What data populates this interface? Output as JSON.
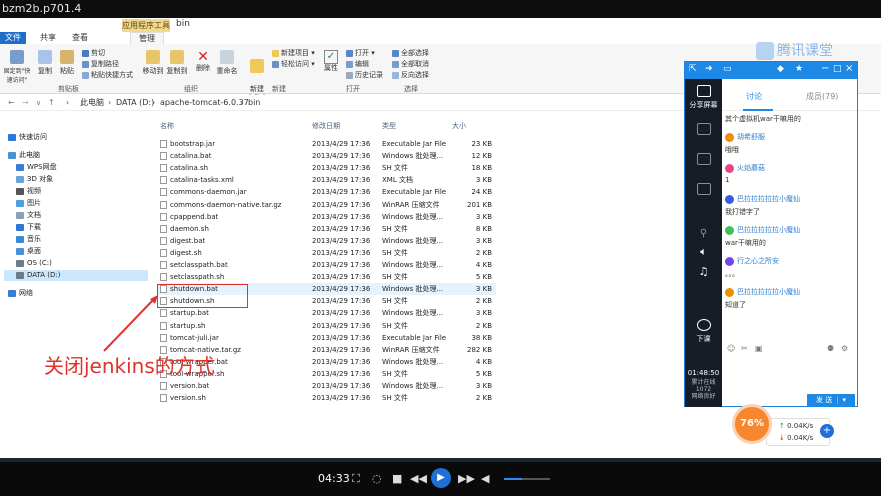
{
  "player": {
    "title": "bzm2b.p701.4",
    "time": "04:33",
    "volume_level": 0.4,
    "icons": [
      "fullscreen-icon",
      "list-icon",
      "stop-icon",
      "prev-icon",
      "play-icon",
      "next-icon",
      "repeat-icon",
      "volume-icon"
    ]
  },
  "explorer": {
    "app_tools_tab": "应用程序工具",
    "window_name": "bin",
    "tabs": [
      "文件",
      "共享",
      "查看",
      "管理"
    ],
    "ribbon": {
      "pin": "固定到\"快速访问\"",
      "copy": "复制",
      "paste": "粘贴",
      "cut": "剪切",
      "copy_path": "复制路径",
      "paste_shortcut": "粘贴快捷方式",
      "move_to": "移动到",
      "copy_to": "复制到",
      "delete": "删除",
      "rename": "重命名",
      "new_folder": "新建\n文件夹",
      "new_item": "新建项目 ▾",
      "easy_access": "轻松访问 ▾",
      "properties": "属性",
      "open": "打开 ▾",
      "edit": "编辑",
      "history": "历史记录",
      "select_all": "全部选择",
      "select_none": "全部取消",
      "invert": "反向选择",
      "groups": {
        "clipboard": "剪贴板",
        "organize": "组织",
        "new": "新建",
        "open": "打开",
        "select": "选择"
      }
    },
    "address": {
      "crumbs": [
        "此电脑",
        "DATA (D:)",
        "apache-tomcat-6.0.37",
        "bin"
      ]
    },
    "nav": [
      {
        "label": "快速访问",
        "type": "star"
      },
      {
        "label": "此电脑",
        "type": "pc"
      },
      {
        "label": "WPS网盘",
        "type": "cloud"
      },
      {
        "label": "3D 对象",
        "type": "folder"
      },
      {
        "label": "视频",
        "type": "folder"
      },
      {
        "label": "图片",
        "type": "folder"
      },
      {
        "label": "文档",
        "type": "folder"
      },
      {
        "label": "下载",
        "type": "folder"
      },
      {
        "label": "音乐",
        "type": "folder"
      },
      {
        "label": "桌面",
        "type": "folder"
      },
      {
        "label": "OS (C:)",
        "type": "drive"
      },
      {
        "label": "DATA (D:)",
        "type": "drive"
      },
      {
        "label": "网络",
        "type": "net"
      }
    ],
    "columns": {
      "name": "名称",
      "date": "修改日期",
      "type": "类型",
      "size": "大小"
    },
    "files": [
      {
        "name": "bootstrap.jar",
        "date": "2013/4/29 17:36",
        "type": "Executable Jar File",
        "size": "23 KB"
      },
      {
        "name": "catalina.bat",
        "date": "2013/4/29 17:36",
        "type": "Windows 批处理...",
        "size": "12 KB"
      },
      {
        "name": "catalina.sh",
        "date": "2013/4/29 17:36",
        "type": "SH 文件",
        "size": "18 KB"
      },
      {
        "name": "catalina-tasks.xml",
        "date": "2013/4/29 17:36",
        "type": "XML 文档",
        "size": "3 KB"
      },
      {
        "name": "commons-daemon.jar",
        "date": "2013/4/29 17:36",
        "type": "Executable Jar File",
        "size": "24 KB"
      },
      {
        "name": "commons-daemon-native.tar.gz",
        "date": "2013/4/29 17:36",
        "type": "WinRAR 压缩文件",
        "size": "201 KB"
      },
      {
        "name": "cpappend.bat",
        "date": "2013/4/29 17:36",
        "type": "Windows 批处理...",
        "size": "3 KB"
      },
      {
        "name": "daemon.sh",
        "date": "2013/4/29 17:36",
        "type": "SH 文件",
        "size": "8 KB"
      },
      {
        "name": "digest.bat",
        "date": "2013/4/29 17:36",
        "type": "Windows 批处理...",
        "size": "3 KB"
      },
      {
        "name": "digest.sh",
        "date": "2013/4/29 17:36",
        "type": "SH 文件",
        "size": "2 KB"
      },
      {
        "name": "setclasspath.bat",
        "date": "2013/4/29 17:36",
        "type": "Windows 批处理...",
        "size": "4 KB"
      },
      {
        "name": "setclasspath.sh",
        "date": "2013/4/29 17:36",
        "type": "SH 文件",
        "size": "5 KB"
      },
      {
        "name": "shutdown.bat",
        "date": "2013/4/29 17:36",
        "type": "Windows 批处理...",
        "size": "3 KB"
      },
      {
        "name": "shutdown.sh",
        "date": "2013/4/29 17:36",
        "type": "SH 文件",
        "size": "2 KB"
      },
      {
        "name": "startup.bat",
        "date": "2013/4/29 17:36",
        "type": "Windows 批处理...",
        "size": "3 KB"
      },
      {
        "name": "startup.sh",
        "date": "2013/4/29 17:36",
        "type": "SH 文件",
        "size": "2 KB"
      },
      {
        "name": "tomcat-juli.jar",
        "date": "2013/4/29 17:36",
        "type": "Executable Jar File",
        "size": "38 KB"
      },
      {
        "name": "tomcat-native.tar.gz",
        "date": "2013/4/29 17:36",
        "type": "WinRAR 压缩文件",
        "size": "282 KB"
      },
      {
        "name": "tool-wrapper.bat",
        "date": "2013/4/29 17:36",
        "type": "Windows 批处理...",
        "size": "4 KB"
      },
      {
        "name": "tool-wrapper.sh",
        "date": "2013/4/29 17:36",
        "type": "SH 文件",
        "size": "5 KB"
      },
      {
        "name": "version.bat",
        "date": "2013/4/29 17:36",
        "type": "Windows 批处理...",
        "size": "3 KB"
      },
      {
        "name": "version.sh",
        "date": "2013/4/29 17:36",
        "type": "SH 文件",
        "size": "2 KB"
      }
    ]
  },
  "annotation": {
    "text": "关闭jenkins的方式",
    "color": "#e0322a"
  },
  "logo": {
    "text": "腾讯课堂"
  },
  "chat": {
    "sidebar": {
      "share_screen": "分享屏幕",
      "download": "下课",
      "time": "01:48:50",
      "stats": "累计在线\n1072\n网络良好"
    },
    "tabs": {
      "discuss": "讨论",
      "members": "成员(79)"
    },
    "messages": [
      {
        "kind": "text",
        "text": "其个虚拟机war干嘛用的"
      },
      {
        "kind": "name",
        "text": "胡希舒服"
      },
      {
        "kind": "text",
        "text": "哦哦"
      },
      {
        "kind": "name",
        "text": "火焰蘑菇"
      },
      {
        "kind": "text",
        "text": "1"
      },
      {
        "kind": "name",
        "text": "巴拉拉拉拉拉小魔仙"
      },
      {
        "kind": "text",
        "text": "我打错字了"
      },
      {
        "kind": "name",
        "text": "巴拉拉拉拉拉小魔仙"
      },
      {
        "kind": "text",
        "text": "war干嘛用的"
      },
      {
        "kind": "name",
        "text": "行之心之所安"
      },
      {
        "kind": "text",
        "text": "。。。"
      },
      {
        "kind": "name",
        "text": "巴拉拉拉拉拉小魔仙"
      },
      {
        "kind": "text",
        "text": "知道了"
      }
    ],
    "send_label": "发 送"
  },
  "speed": {
    "percent": "76%",
    "up": "0.04K/s",
    "down": "0.04K/s"
  },
  "colors": {
    "accent": "#1e88e5",
    "annotation": "#e0322a",
    "file_tab": "#1e6fc7",
    "tool_tab": "#f5d98b"
  }
}
